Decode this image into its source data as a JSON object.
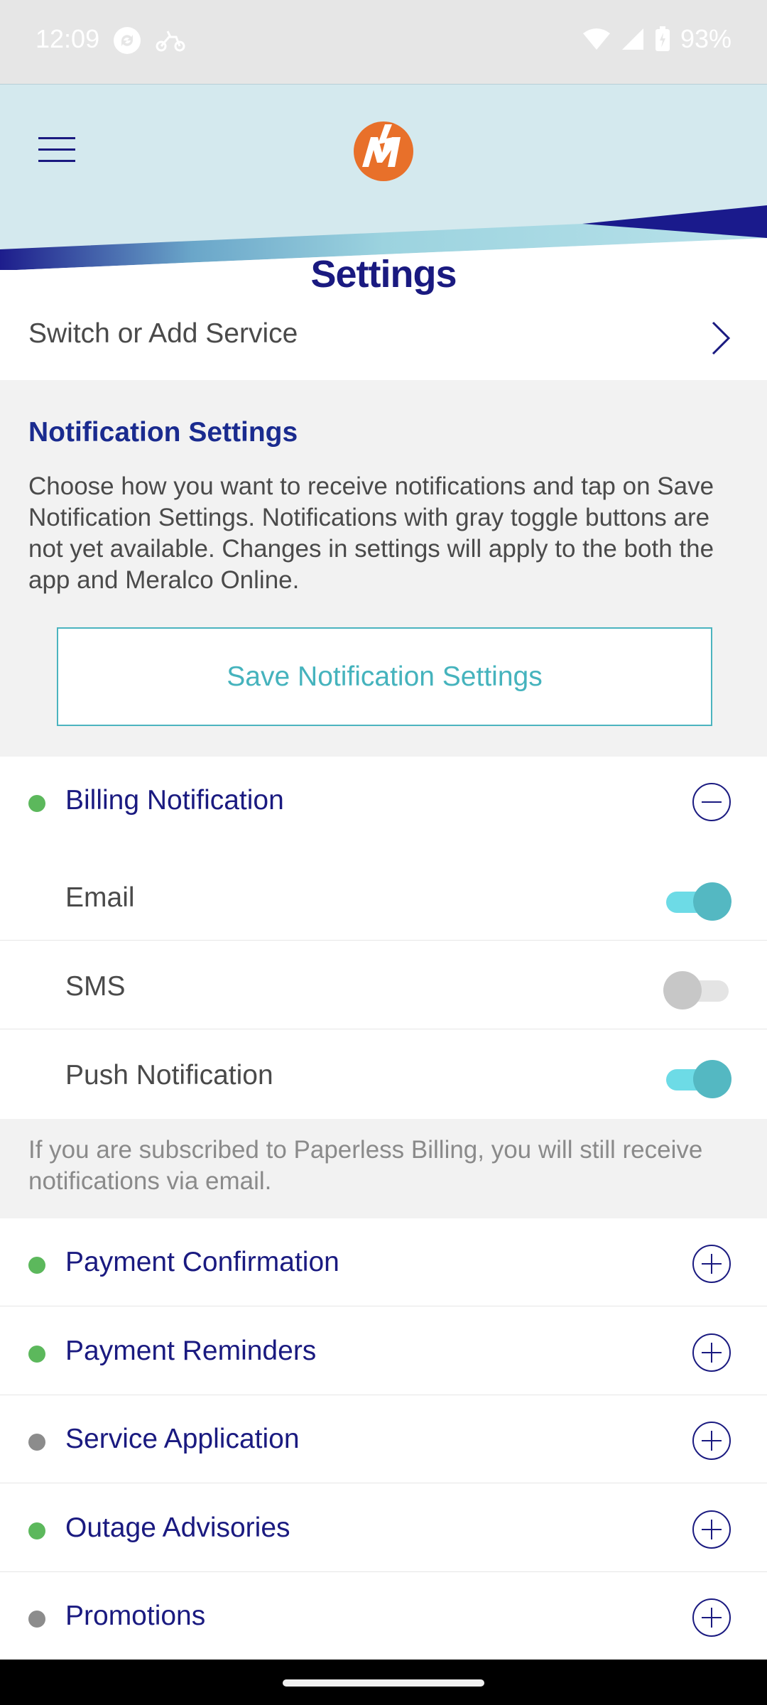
{
  "status_bar": {
    "time": "12:09",
    "battery": "93%",
    "icons": [
      "sync-icon",
      "scooter-icon",
      "wifi-icon",
      "signal-icon",
      "battery-icon"
    ]
  },
  "header": {
    "menu_icon": "hamburger-menu-icon",
    "logo": "meralco-logo",
    "title": "Settings"
  },
  "switch_service": {
    "label": "Switch or Add Service",
    "icon": "chevron-right-icon"
  },
  "notification_settings": {
    "title": "Notification Settings",
    "description": "Choose how you want to receive notifications and tap on Save Notification Settings. Notifications with gray toggle buttons are not yet available. Changes in settings will apply to the both the app and Meralco Online.",
    "save_button": "Save Notification Settings"
  },
  "billing": {
    "label": "Billing Notification",
    "status": "available",
    "expanded": true,
    "channels": [
      {
        "label": "Email",
        "enabled": true
      },
      {
        "label": "SMS",
        "enabled": false
      },
      {
        "label": "Push Notification",
        "enabled": true
      }
    ],
    "note": "If you are subscribed to Paperless Billing, you will still receive notifications via email."
  },
  "categories": [
    {
      "label": "Payment Confirmation",
      "status": "available"
    },
    {
      "label": "Payment Reminders",
      "status": "available"
    },
    {
      "label": "Service Application",
      "status": "unavailable"
    },
    {
      "label": "Outage Advisories",
      "status": "available"
    },
    {
      "label": "Promotions",
      "status": "unavailable"
    }
  ],
  "colors": {
    "primary_navy": "#1a1a80",
    "accent_teal": "#45b3bd",
    "status_green": "#5cb85c",
    "status_gray": "#8c8c8c",
    "logo_orange": "#e8702a"
  }
}
